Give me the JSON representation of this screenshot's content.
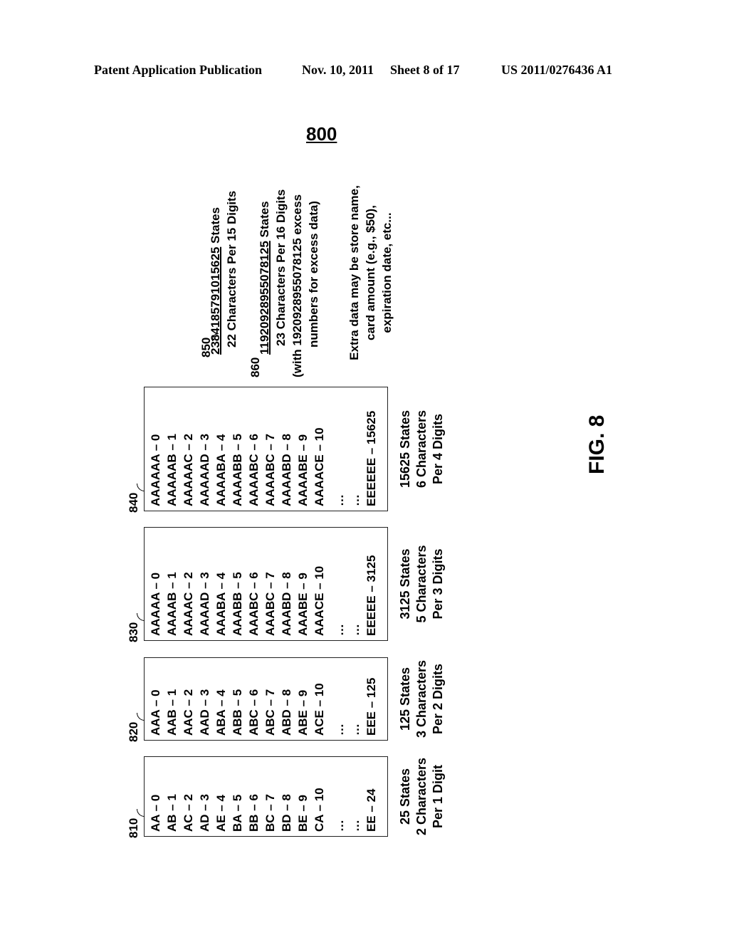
{
  "header": {
    "publication": "Patent Application Publication",
    "date": "Nov. 10, 2011",
    "sheet": "Sheet 8 of 17",
    "number": "US 2011/0276436 A1"
  },
  "figure": {
    "ref": "800",
    "label": "FIG. 8",
    "tables": [
      {
        "ref": "810",
        "entries": [
          "AA – 0",
          "AB – 1",
          "AC – 2",
          "AD – 3",
          "AE – 4",
          "BA – 5",
          "BB – 6",
          "BC – 7",
          "BD – 8",
          "BE – 9",
          "CA – 10",
          "…",
          "…",
          "EE – 24"
        ],
        "caption": [
          "25 States",
          "2 Characters",
          "Per 1 Digit"
        ]
      },
      {
        "ref": "820",
        "entries": [
          "AAA – 0",
          "AAB – 1",
          "AAC – 2",
          "AAD – 3",
          "ABA – 4",
          "ABB – 5",
          "ABC – 6",
          "ABC – 7",
          "ABD – 8",
          "ABE – 9",
          "ACE – 10",
          "…",
          "…",
          "EEE – 125"
        ],
        "caption": [
          "125 States",
          "3 Characters",
          "Per 2 Digits"
        ]
      },
      {
        "ref": "830",
        "entries": [
          "AAAAA – 0",
          "AAAAB – 1",
          "AAAAC – 2",
          "AAAAD – 3",
          "AAABA – 4",
          "AAABB – 5",
          "AAABC – 6",
          "AAABC – 7",
          "AAABD – 8",
          "AAABE – 9",
          "AAACE – 10",
          "…",
          "…",
          "EEEEE – 3125"
        ],
        "caption": [
          "3125 States",
          "5 Characters",
          "Per 3 Digits"
        ]
      },
      {
        "ref": "840",
        "entries": [
          "AAAAAA – 0",
          "AAAAAB – 1",
          "AAAAAC – 2",
          "AAAAAD – 3",
          "AAAABA – 4",
          "AAAABB – 5",
          "AAAABC – 6",
          "AAAABC – 7",
          "AAAABD – 8",
          "AAAABE – 9",
          "AAAACE – 10",
          "…",
          "…",
          "EEEEEE – 15625"
        ],
        "caption": [
          "15625 States",
          "6 Characters",
          "Per 4 Digits"
        ]
      }
    ],
    "notes": {
      "n850": {
        "ref": "850",
        "states_number": "2384185791015625",
        "states_suffix": " States",
        "line2": "22 Characters Per 15 Digits"
      },
      "n860": {
        "ref": "860",
        "states_number": "11920928955078125",
        "states_suffix": " States",
        "line2": "23 Characters Per 16 Digits",
        "line3": "(with 1920928955078125 excess",
        "line4": "numbers for excess data)"
      },
      "extra": [
        "Extra data may be store name,",
        "card amount (e.g., $50),",
        "expiration date, etc..."
      ]
    }
  }
}
